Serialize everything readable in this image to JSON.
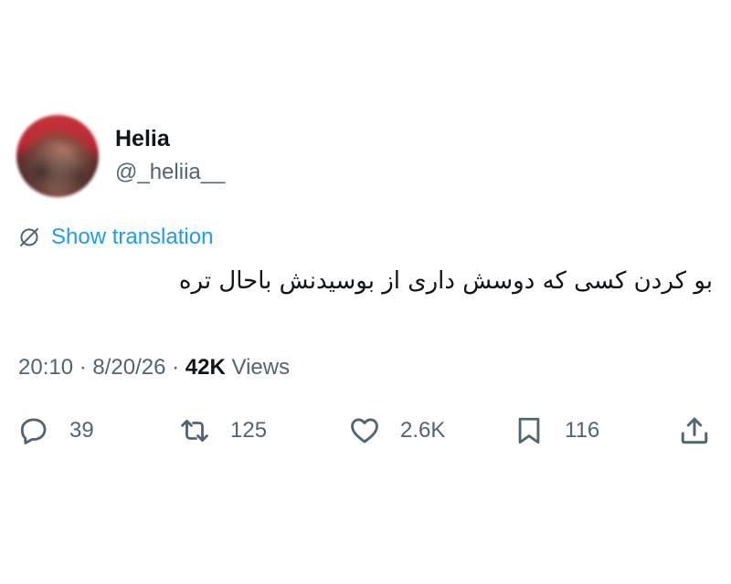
{
  "author": {
    "name": "Helia",
    "handle": "@_heliia__"
  },
  "translation": {
    "label": "Show translation",
    "icon": "translate-icon"
  },
  "tweet": {
    "text": "بو کردن کسی که دوسش داری از بوسیدنش باحال تره"
  },
  "meta": {
    "time": "20:10",
    "separator1": " · ",
    "date": "8/20/26",
    "separator2": " · ",
    "views_count": "42K",
    "views_label": " Views"
  },
  "actions": {
    "replies": "39",
    "retweets": "125",
    "likes": "2.6K",
    "bookmarks": "116"
  },
  "colors": {
    "accent": "#1d9bf0",
    "text_primary": "#0f1419",
    "text_secondary": "#536471"
  }
}
